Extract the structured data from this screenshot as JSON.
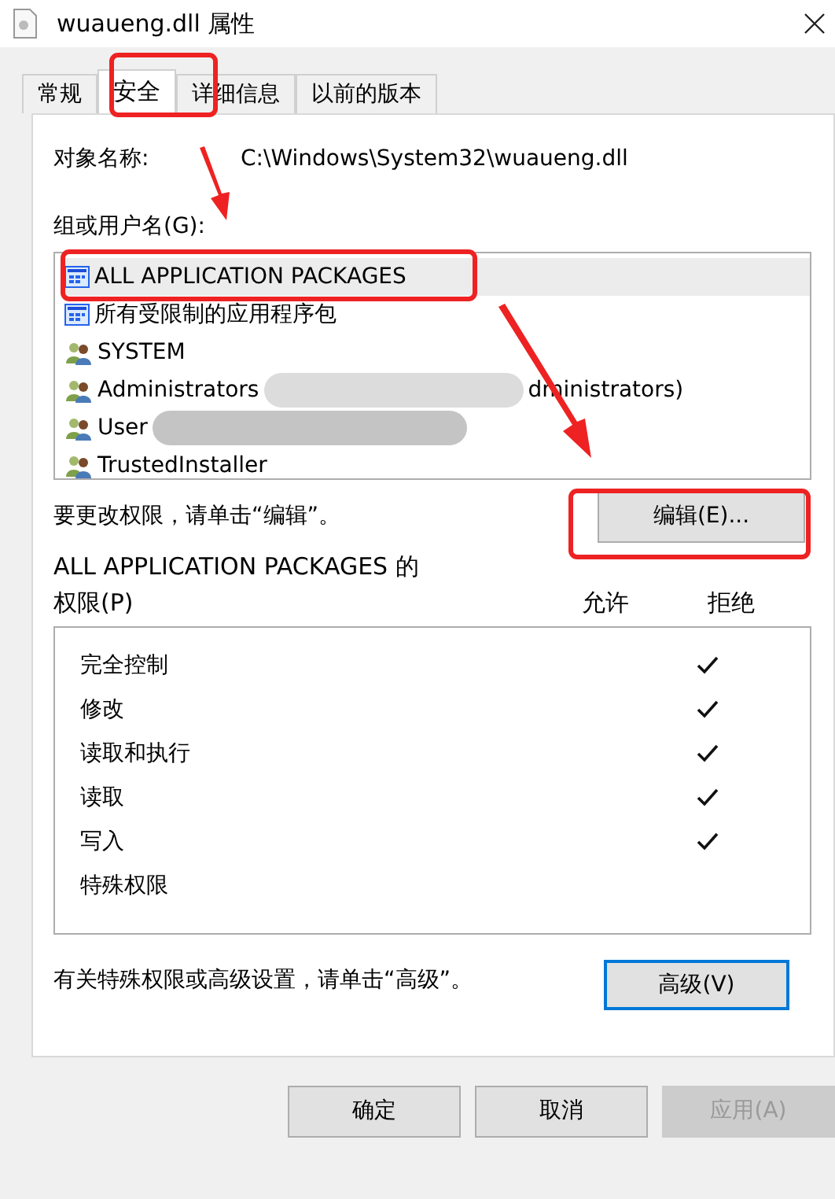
{
  "window": {
    "title": "wuaueng.dll 属性"
  },
  "tabs": [
    {
      "label": "常规",
      "selected": false
    },
    {
      "label": "安全",
      "selected": true
    },
    {
      "label": "详细信息",
      "selected": false
    },
    {
      "label": "以前的版本",
      "selected": false
    }
  ],
  "object_name": {
    "label": "对象名称:",
    "value": "C:\\Windows\\System32\\wuaueng.dll"
  },
  "groups": {
    "label": "组或用户名(G):",
    "items": [
      {
        "kind": "package",
        "name": "ALL APPLICATION PACKAGES",
        "selected": true
      },
      {
        "kind": "package",
        "name": "所有受限制的应用程序包",
        "selected": false
      },
      {
        "kind": "user",
        "name": "SYSTEM",
        "selected": false
      },
      {
        "kind": "user",
        "name": "Administrators",
        "redacted": true,
        "suffix": "dministrators)",
        "selected": false
      },
      {
        "kind": "user",
        "name": "User",
        "redacted": true,
        "selected": false
      },
      {
        "kind": "user",
        "name": "TrustedInstaller",
        "selected": false
      }
    ]
  },
  "edit_hint": "要更改权限，请单击“编辑”。",
  "edit_button": "编辑(E)...",
  "permissions": {
    "title": "ALL APPLICATION PACKAGES 的",
    "label": "权限(P)",
    "allow_header": "允许",
    "deny_header": "拒绝",
    "rows": [
      {
        "name": "完全控制",
        "allow": false,
        "deny": true
      },
      {
        "name": "修改",
        "allow": false,
        "deny": true
      },
      {
        "name": "读取和执行",
        "allow": false,
        "deny": true
      },
      {
        "name": "读取",
        "allow": false,
        "deny": true
      },
      {
        "name": "写入",
        "allow": false,
        "deny": true
      },
      {
        "name": "特殊权限",
        "allow": false,
        "deny": false
      }
    ]
  },
  "advanced_hint": "有关特殊权限或高级设置，请单击“高级”。",
  "advanced_button": "高级(V)",
  "buttons": [
    {
      "label": "确定",
      "disabled": false
    },
    {
      "label": "取消",
      "disabled": false
    },
    {
      "label": "应用(A)",
      "disabled": true
    }
  ]
}
